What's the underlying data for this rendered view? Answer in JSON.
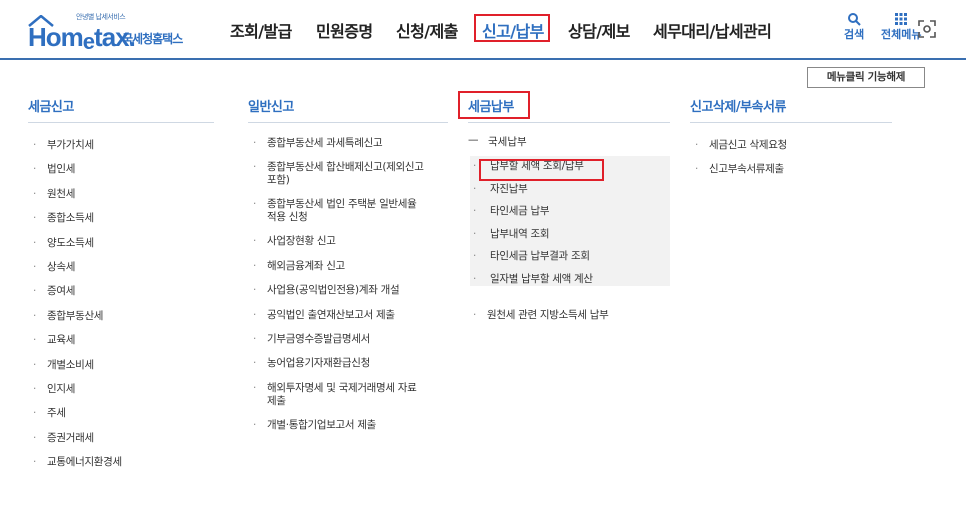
{
  "logo": {
    "small_text": "안녕별 납세서비스",
    "home_text": "Hom",
    "e_text": "e",
    "tax_text": "tax.",
    "korean_text": "국세청홈택스"
  },
  "nav": {
    "items": [
      "조회/발급",
      "민원증명",
      "신청/제출",
      "신고/납부",
      "상담/제보",
      "세무대리/납세관리"
    ]
  },
  "tools": {
    "search": "검색",
    "all_menu": "전체메뉴"
  },
  "release_button": "메뉴클릭 기능해제",
  "columns": {
    "tax_report": {
      "title": "세금신고",
      "items": [
        "부가가치세",
        "법인세",
        "원천세",
        "종합소득세",
        "양도소득세",
        "상속세",
        "증여세",
        "종합부동산세",
        "교육세",
        "개별소비세",
        "인지세",
        "주세",
        "증권거래세",
        "교통에너지환경세"
      ]
    },
    "general_report": {
      "title": "일반신고",
      "items": [
        [
          "종합부동산세 과세특례신고"
        ],
        [
          "종합부동산세 합산배제신고(제외신고",
          "포함)"
        ],
        [
          "종합부동산세 법인 주택분 일반세율",
          "적용 신청"
        ],
        [
          "사업장현황 신고"
        ],
        [
          "해외금융계좌 신고"
        ],
        [
          "사업용(공익법인전용)계좌 개설"
        ],
        [
          "공익법인 출연재산보고서 제출"
        ],
        [
          "기부금영수증발급명세서"
        ],
        [
          "농어업용기자재환급신청"
        ],
        [
          "해외투자명세 및 국제거래명세 자료",
          "제출"
        ],
        [
          "개별·통합기업보고서 제출"
        ]
      ]
    },
    "tax_payment": {
      "title": "세금납부",
      "group_label": "국세납부",
      "sub_items": [
        "납부할 세액 조회/납부",
        "자진납부",
        "타인세금 납부",
        "납부내역 조회",
        "타인세금 납부결과 조회",
        "일자별 납부할 세액 계산"
      ],
      "extra_item": "원천세 관련 지방소득세 납부"
    },
    "delete_docs": {
      "title": "신고삭제/부속서류",
      "items": [
        "세금신고 삭제요청",
        "신고부속서류제출"
      ]
    }
  }
}
